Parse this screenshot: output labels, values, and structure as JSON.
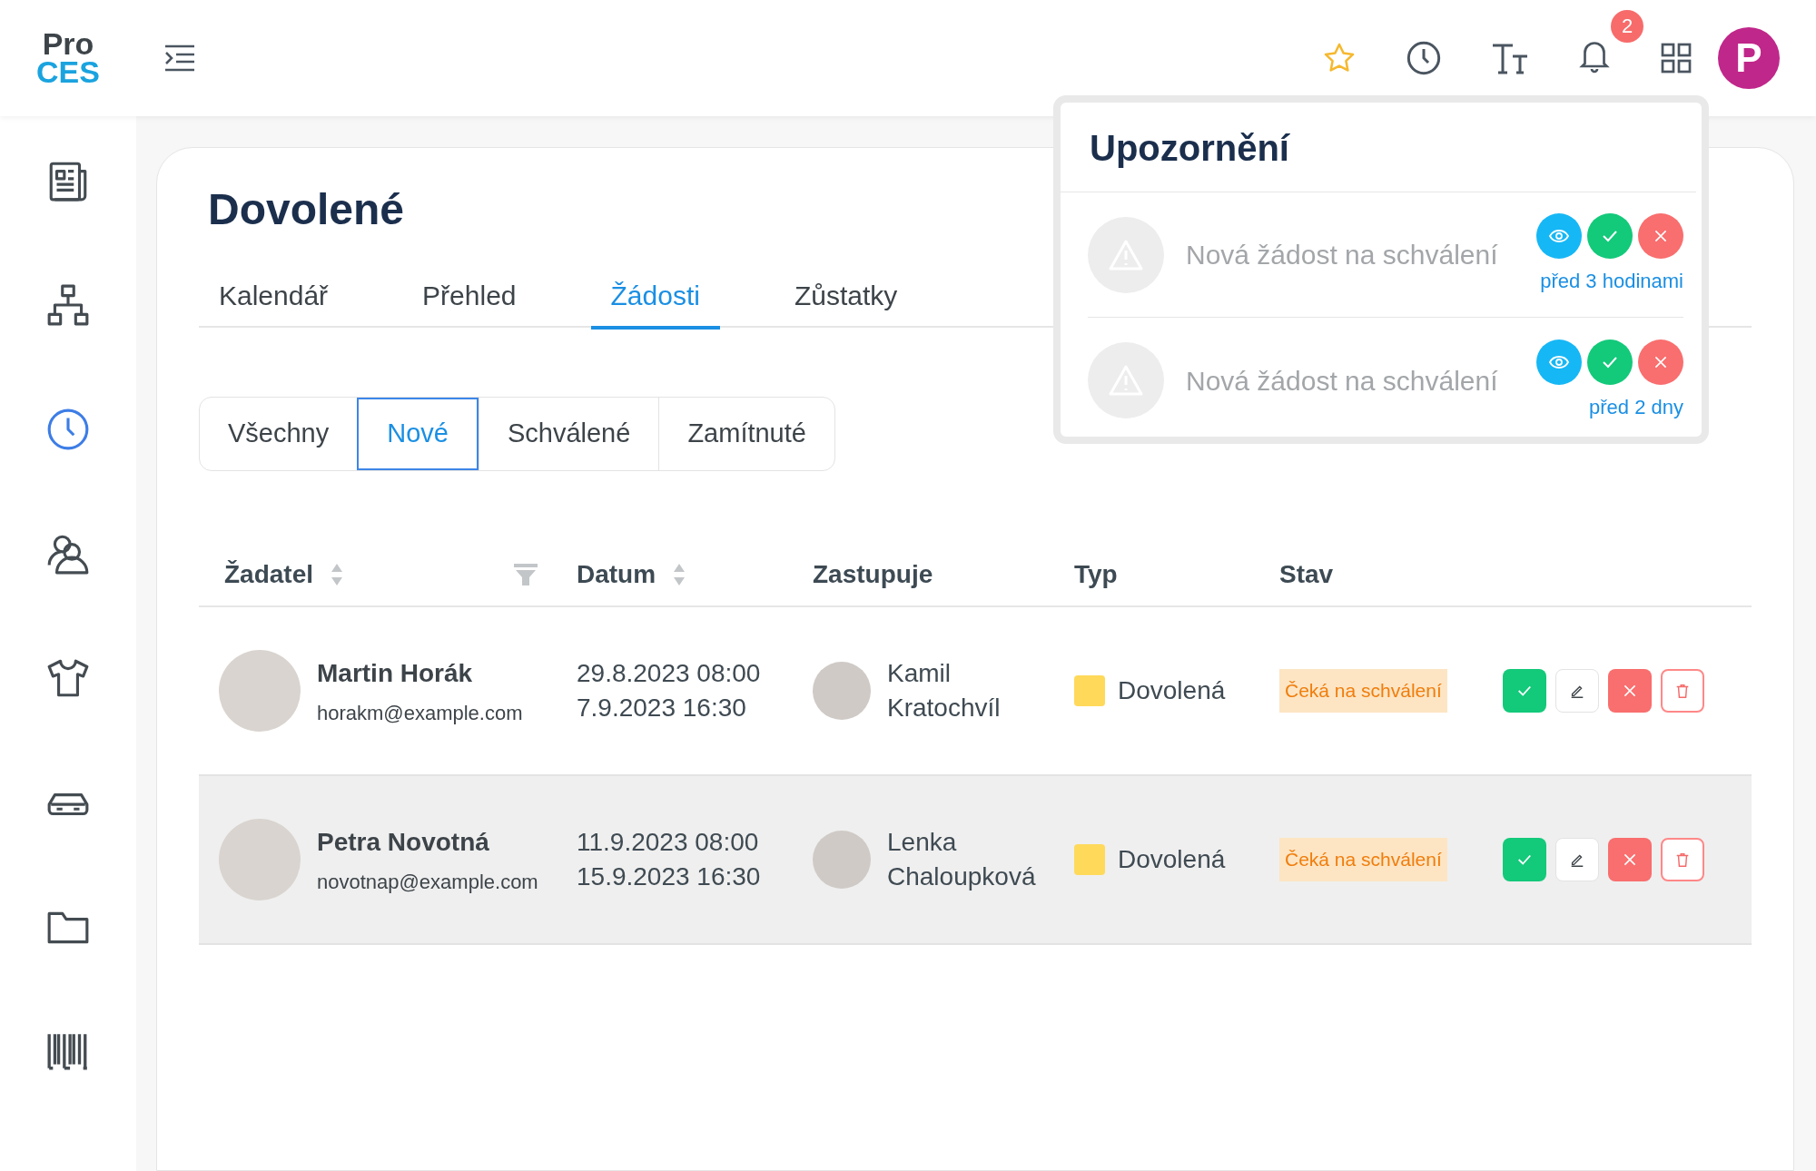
{
  "logo": {
    "line1": "Pro",
    "line2": "CES"
  },
  "header": {
    "notification_count": "2",
    "user_initial": "P"
  },
  "sidebar": {
    "items": [
      {
        "kind": "news",
        "selected": false
      },
      {
        "kind": "org",
        "selected": false
      },
      {
        "kind": "clock",
        "selected": true
      },
      {
        "kind": "people",
        "selected": false
      },
      {
        "kind": "shirt",
        "selected": false
      },
      {
        "kind": "car",
        "selected": false
      },
      {
        "kind": "folder",
        "selected": false
      },
      {
        "kind": "barcode",
        "selected": false
      }
    ]
  },
  "page": {
    "title": "Dovolené"
  },
  "tabs": [
    {
      "label": "Kalendář",
      "selected": false
    },
    {
      "label": "Přehled",
      "selected": false
    },
    {
      "label": "Žádosti",
      "selected": true
    },
    {
      "label": "Zůstatky",
      "selected": false
    }
  ],
  "filters": [
    {
      "label": "Všechny",
      "selected": false
    },
    {
      "label": "Nové",
      "selected": true
    },
    {
      "label": "Schválené",
      "selected": false
    },
    {
      "label": "Zamítnuté",
      "selected": false
    }
  ],
  "table": {
    "columns": [
      "Žadatel",
      "Datum",
      "Zastupuje",
      "Typ",
      "Stav"
    ],
    "rows": [
      {
        "name": "Martin Horák",
        "email": "horakm@example.com",
        "from": "29.8.2023 08:00",
        "to": "7.9.2023 16:30",
        "deputy": [
          "Kamil",
          "Kratochvíl"
        ],
        "type": "Dovolená",
        "color": "#ffd95a",
        "status": "Čeká na schválení",
        "highlighted": false
      },
      {
        "name": "Petra Novotná",
        "email": "novotnap@example.com",
        "from": "11.9.2023 08:00",
        "to": "15.9.2023 16:30",
        "deputy": [
          "Lenka",
          "Chaloupková"
        ],
        "type": "Dovolená",
        "color": "#ffd95a",
        "status": "Čeká na schválení",
        "highlighted": true
      }
    ]
  },
  "notifications": {
    "title": "Upozornění",
    "items": [
      {
        "text": "Nová žádost na schválení",
        "time": "před 3 hodinami"
      },
      {
        "text": "Nová žádost na schválení",
        "time": "před 2 dny"
      }
    ]
  }
}
